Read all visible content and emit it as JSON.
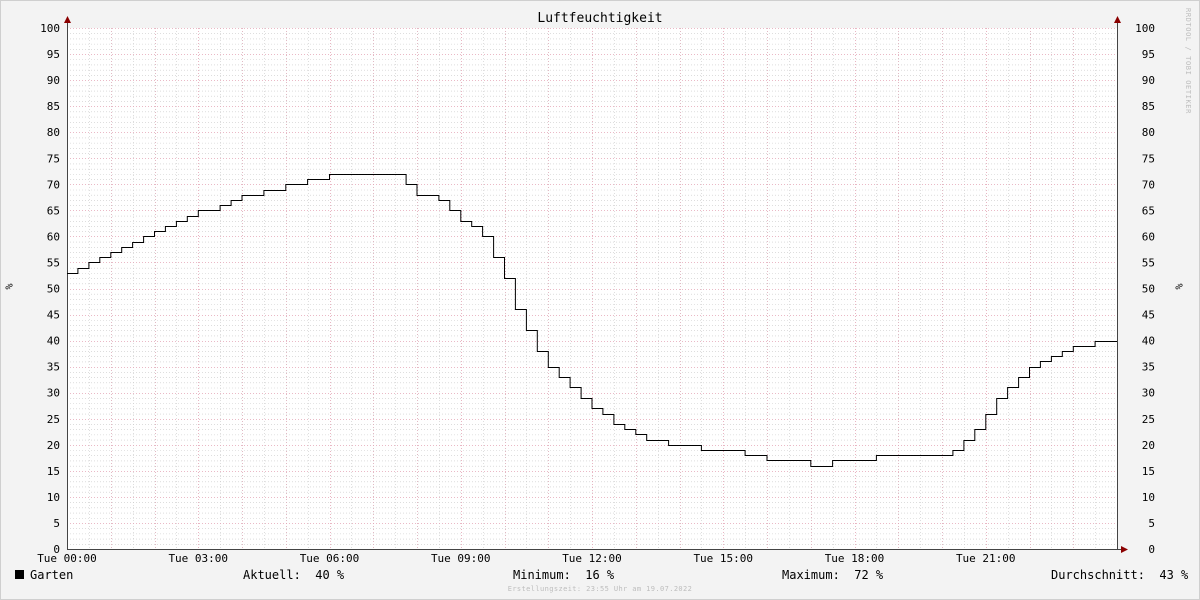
{
  "chart_data": {
    "type": "line",
    "title": "Luftfeuchtigkeit",
    "ylabel": "%",
    "ylim": [
      0,
      100
    ],
    "y_ticks": [
      0,
      5,
      10,
      15,
      20,
      25,
      30,
      35,
      40,
      45,
      50,
      55,
      60,
      65,
      70,
      75,
      80,
      85,
      90,
      95,
      100
    ],
    "xlim_hours": [
      0,
      24
    ],
    "x_ticks": [
      {
        "hour": 0,
        "label": "Tue 00:00"
      },
      {
        "hour": 3,
        "label": "Tue 03:00"
      },
      {
        "hour": 6,
        "label": "Tue 06:00"
      },
      {
        "hour": 9,
        "label": "Tue 09:00"
      },
      {
        "hour": 12,
        "label": "Tue 12:00"
      },
      {
        "hour": 15,
        "label": "Tue 15:00"
      },
      {
        "hour": 18,
        "label": "Tue 18:00"
      },
      {
        "hour": 21,
        "label": "Tue 21:00"
      }
    ],
    "grid": true,
    "series": [
      {
        "name": "Garten",
        "color": "#000000",
        "x": [
          0.0,
          0.25,
          0.5,
          0.75,
          1.0,
          1.25,
          1.5,
          1.75,
          2.0,
          2.25,
          2.5,
          2.75,
          3.0,
          3.5,
          3.75,
          4.0,
          4.5,
          5.0,
          5.5,
          6.0,
          6.5,
          7.0,
          7.5,
          7.75,
          8.0,
          8.5,
          8.75,
          9.0,
          9.25,
          9.5,
          9.75,
          10.0,
          10.25,
          10.5,
          10.75,
          11.0,
          11.25,
          11.5,
          11.75,
          12.0,
          12.25,
          12.5,
          12.75,
          13.0,
          13.25,
          13.5,
          13.75,
          14.0,
          14.5,
          15.0,
          15.5,
          16.0,
          16.5,
          17.0,
          17.5,
          18.0,
          18.5,
          19.0,
          19.5,
          20.0,
          20.25,
          20.5,
          20.75,
          21.0,
          21.25,
          21.5,
          21.75,
          22.0,
          22.25,
          22.5,
          22.75,
          23.0,
          23.25,
          23.5,
          23.75,
          24.0
        ],
        "values": [
          53,
          54,
          55,
          56,
          57,
          58,
          59,
          60,
          61,
          62,
          63,
          64,
          65,
          66,
          67,
          68,
          69,
          70,
          71,
          72,
          72,
          72,
          72,
          70,
          68,
          67,
          65,
          63,
          62,
          60,
          56,
          52,
          46,
          42,
          38,
          35,
          33,
          31,
          29,
          27,
          26,
          24,
          23,
          22,
          21,
          21,
          20,
          20,
          19,
          19,
          18,
          17,
          17,
          16,
          17,
          17,
          18,
          18,
          18,
          18,
          19,
          21,
          23,
          26,
          29,
          31,
          33,
          35,
          36,
          37,
          38,
          39,
          39,
          40,
          40,
          40
        ]
      }
    ]
  },
  "legend": {
    "series_name": "Garten",
    "current_label": "Aktuell:",
    "current_value": "40 %",
    "min_label": "Minimum:",
    "min_value": "16 %",
    "max_label": "Maximum:",
    "max_value": "72 %",
    "avg_label": "Durchschnitt:",
    "avg_value": "43 %"
  },
  "watermark": "RRDTOOL / TOBI OETIKER",
  "created": "Erstellungszeit: 23:55 Uhr am 19.07.2022",
  "colors": {
    "line": "#000000",
    "major_grid": "#e3a3b4",
    "minor_grid": "#c9c9c9",
    "axis_arrow": "#8b0000",
    "plot_background": "#ffffff",
    "page_background": "#f3f3f3"
  }
}
